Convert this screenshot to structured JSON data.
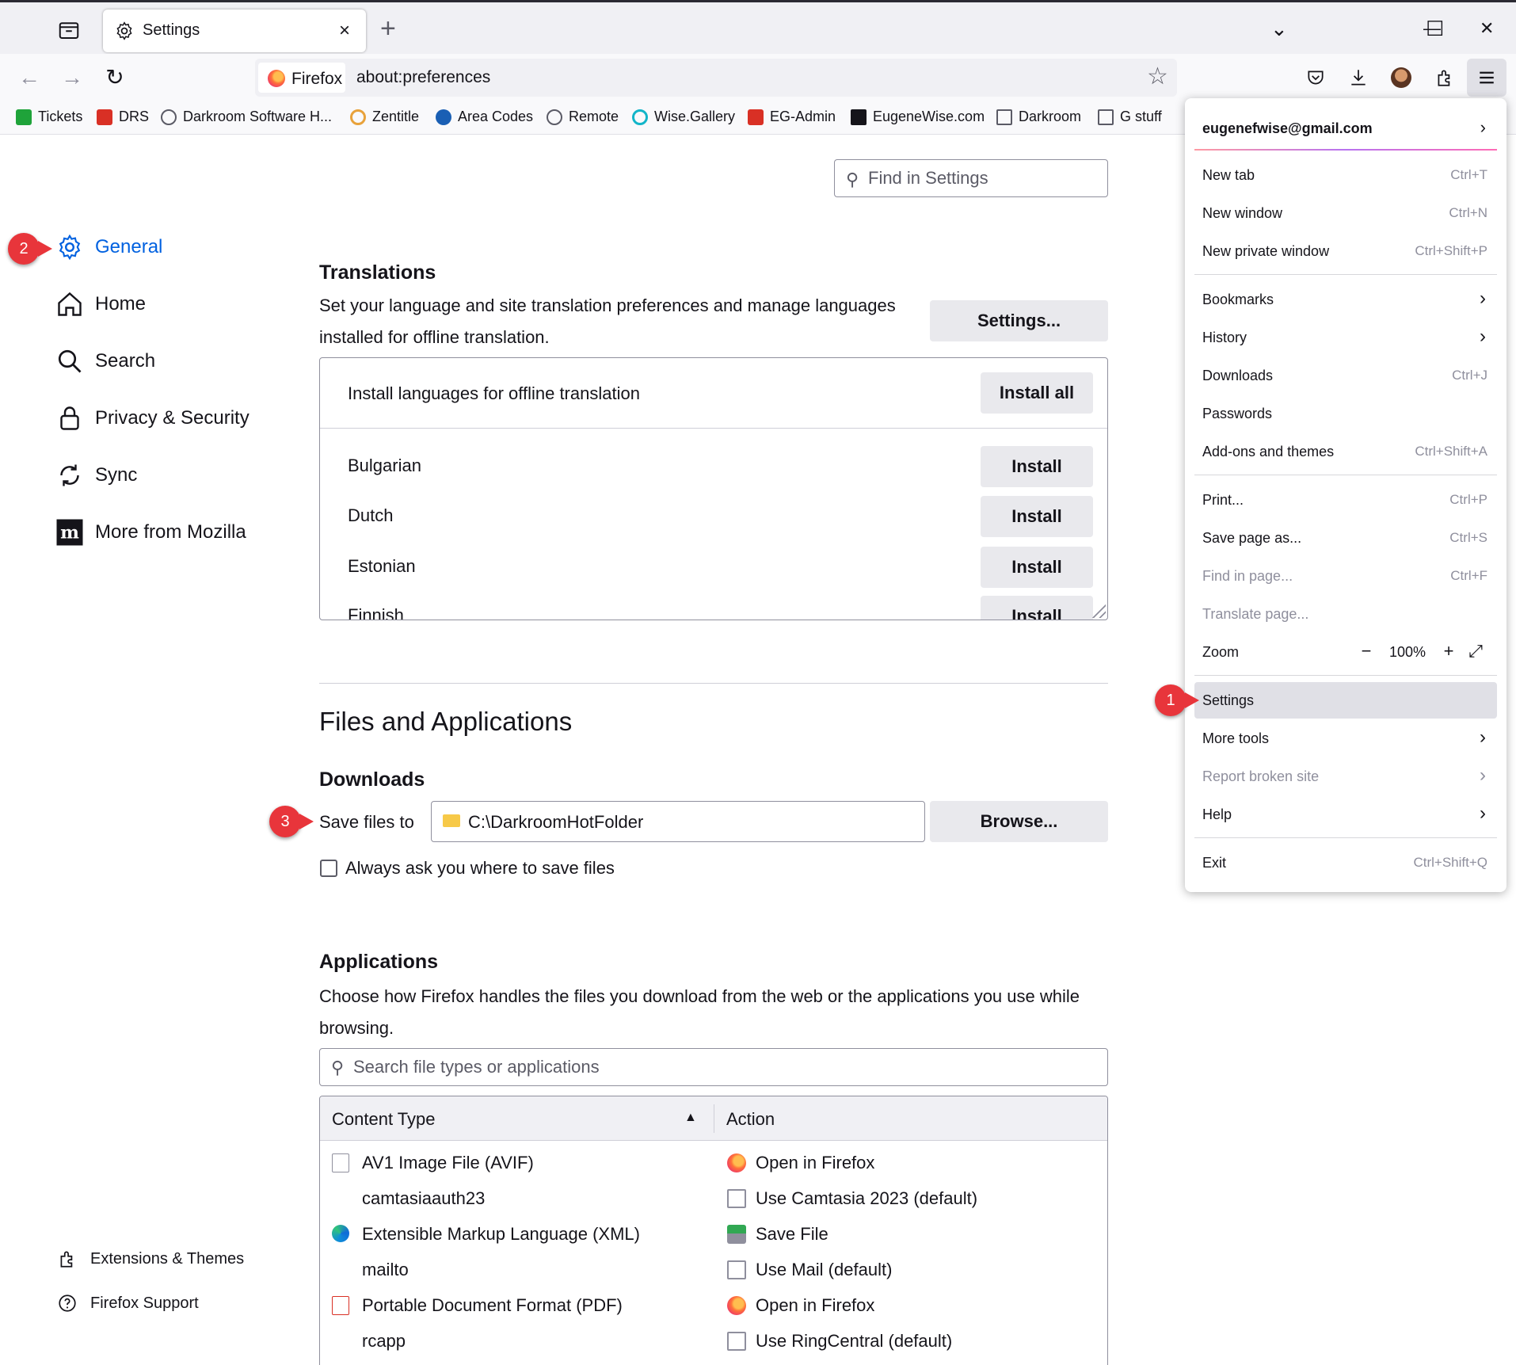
{
  "tab": {
    "title": "Settings",
    "close": "×"
  },
  "newtab": "+",
  "window": {
    "list_all": "⌄",
    "minimize": "—",
    "maximize": "☐",
    "close": "✕"
  },
  "nav": {
    "back": "←",
    "forward": "→",
    "reload": "↻"
  },
  "urlbar": {
    "identity": "Firefox",
    "url": "about:preferences",
    "star": "☆"
  },
  "bookmarks": [
    {
      "label": "Tickets",
      "color": "#1fa33a"
    },
    {
      "label": "DRS",
      "color": "#d93025"
    },
    {
      "label": "Darkroom Software H...",
      "color": "#5b5b66"
    },
    {
      "label": "Zentitle",
      "color": "#e8a23b"
    },
    {
      "label": "Area Codes",
      "color": "#1a5fb4"
    },
    {
      "label": "Remote",
      "color": "#5b5b66"
    },
    {
      "label": "Wise.Gallery",
      "color": "#12b5c9"
    },
    {
      "label": "EG-Admin",
      "color": "#d93025"
    },
    {
      "label": "EugeneWise.com",
      "color": "#15141a"
    },
    {
      "label": "Darkroom",
      "color": "#ffffff"
    },
    {
      "label": "G stuff",
      "color": "#ffffff"
    }
  ],
  "sidebar": {
    "items": [
      {
        "label": "General"
      },
      {
        "label": "Home"
      },
      {
        "label": "Search"
      },
      {
        "label": "Privacy & Security"
      },
      {
        "label": "Sync"
      },
      {
        "label": "More from Mozilla"
      }
    ],
    "footer": [
      {
        "label": "Extensions & Themes"
      },
      {
        "label": "Firefox Support"
      }
    ]
  },
  "callouts": {
    "one": "1",
    "two": "2",
    "three": "3"
  },
  "find": {
    "placeholder": "Find in Settings"
  },
  "translations": {
    "heading": "Translations",
    "description_line1": "Set your language and site translation preferences and manage languages",
    "description_line2": "installed for offline translation.",
    "settings_button": "Settings...",
    "install_header": "Install languages for offline translation",
    "install_all": "Install all",
    "install": "Install",
    "languages": [
      "Bulgarian",
      "Dutch",
      "Estonian",
      "Finnish"
    ]
  },
  "files_apps": {
    "heading": "Files and Applications",
    "downloads_heading": "Downloads",
    "save_files_label": "Save files to",
    "save_path": "C:\\DarkroomHotFolder",
    "browse_button": "Browse...",
    "always_ask_label": "Always ask you where to save files",
    "always_ask_checked": false,
    "applications_heading": "Applications",
    "applications_desc_line1": "Choose how Firefox handles the files you download from the web or the applications you use while",
    "applications_desc_line2": "browsing.",
    "search_placeholder": "Search file types or applications",
    "col_content_type": "Content Type",
    "col_action": "Action",
    "sort_indicator": "▲",
    "rows": [
      {
        "type": "AV1 Image File (AVIF)",
        "type_icon": "document-icon",
        "action": "Open in Firefox",
        "action_icon": "firefox-icon"
      },
      {
        "type": "camtasiaauth23",
        "type_icon": "",
        "action": "Use Camtasia 2023 (default)",
        "action_icon": "app-window-icon"
      },
      {
        "type": "Extensible Markup Language (XML)",
        "type_icon": "edge-icon",
        "action": "Save File",
        "action_icon": "save-file-icon"
      },
      {
        "type": "mailto",
        "type_icon": "",
        "action": "Use Mail (default)",
        "action_icon": "app-window-icon"
      },
      {
        "type": "Portable Document Format (PDF)",
        "type_icon": "pdf-icon",
        "action": "Open in Firefox",
        "action_icon": "firefox-icon"
      },
      {
        "type": "rcapp",
        "type_icon": "",
        "action": "Use RingCentral (default)",
        "action_icon": "app-window-icon"
      }
    ]
  },
  "app_menu": {
    "account": "eugenefwise@gmail.com",
    "items": [
      {
        "label": "New tab",
        "shortcut": "Ctrl+T"
      },
      {
        "label": "New window",
        "shortcut": "Ctrl+N"
      },
      {
        "label": "New private window",
        "shortcut": "Ctrl+Shift+P"
      },
      {
        "label": "Bookmarks",
        "shortcut": ""
      },
      {
        "label": "History",
        "shortcut": ""
      },
      {
        "label": "Downloads",
        "shortcut": "Ctrl+J"
      },
      {
        "label": "Passwords",
        "shortcut": ""
      },
      {
        "label": "Add-ons and themes",
        "shortcut": "Ctrl+Shift+A"
      },
      {
        "label": "Print...",
        "shortcut": "Ctrl+P"
      },
      {
        "label": "Save page as...",
        "shortcut": "Ctrl+S"
      },
      {
        "label": "Find in page...",
        "shortcut": "Ctrl+F"
      },
      {
        "label": "Translate page...",
        "shortcut": ""
      },
      {
        "label": "Zoom",
        "shortcut": ""
      },
      {
        "label": "Settings",
        "shortcut": ""
      },
      {
        "label": "More tools",
        "shortcut": ""
      },
      {
        "label": "Report broken site",
        "shortcut": ""
      },
      {
        "label": "Help",
        "shortcut": ""
      },
      {
        "label": "Exit",
        "shortcut": "Ctrl+Shift+Q"
      }
    ],
    "zoom": {
      "minus": "−",
      "value": "100%",
      "plus": "+",
      "fullscreen": "⤢"
    }
  },
  "colors": {
    "accent": "#0061e0",
    "callout": "#e8353b"
  }
}
